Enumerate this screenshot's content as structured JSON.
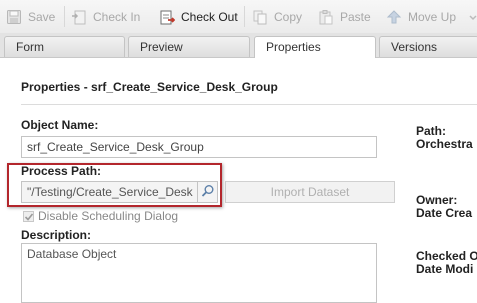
{
  "toolbar": {
    "save": "Save",
    "check_in": "Check In",
    "check_out": "Check Out",
    "copy": "Copy",
    "paste": "Paste",
    "move_up": "Move Up"
  },
  "tabs": [
    "Form",
    "Preview",
    "Properties",
    "Versions"
  ],
  "active_tab": "Properties",
  "properties": {
    "title": "Properties - srf_Create_Service_Desk_Group",
    "object_name_label": "Object Name:",
    "object_name_value": "srf_Create_Service_Desk_Group",
    "process_path_label": "Process Path:",
    "process_path_value": "\"/Testing/Create_Service_Desk",
    "import_dataset_label": "Import Dataset",
    "disable_scheduling_label": "Disable Scheduling Dialog",
    "disable_scheduling_checked": true,
    "description_label": "Description:",
    "description_value": "Database Object"
  },
  "right_labels": {
    "path": "Path:",
    "orchestrator": "Orchestra",
    "owner": "Owner:",
    "date_created": "Date Crea",
    "checked_out": "Checked O",
    "date_modified": "Date Modi"
  },
  "colors": {
    "highlight_border": "#b3262c",
    "toolbar_disabled_text": "#a8a8a8",
    "checkout_icon_red": "#c0392b"
  }
}
